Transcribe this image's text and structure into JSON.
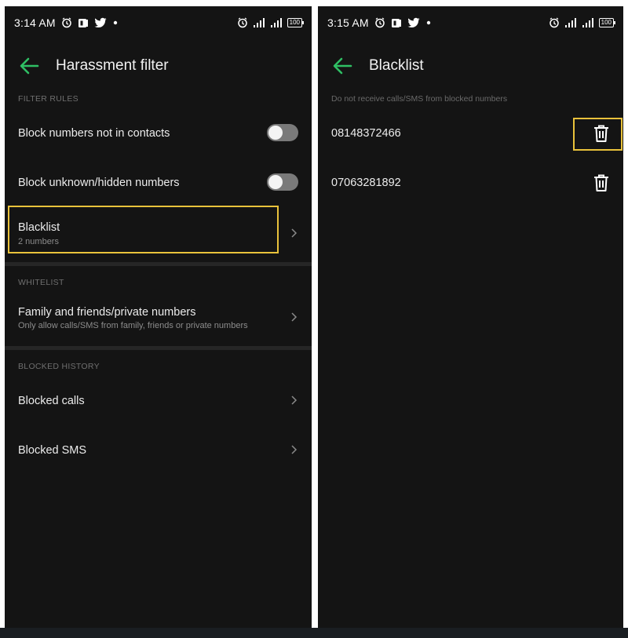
{
  "colors": {
    "accent_green": "#2fbf64",
    "highlight_yellow": "#e9c23b",
    "background": "#141414"
  },
  "left_screen": {
    "status_bar": {
      "time": "3:14 AM",
      "left_icons": [
        "alarm-icon",
        "app-notification-icon",
        "twitter-icon",
        "dot-icon"
      ],
      "right_icons": [
        "alarm-icon",
        "signal-icon",
        "signal-icon",
        "battery-icon"
      ],
      "battery": "100"
    },
    "header": {
      "title": "Harassment filter",
      "back_icon": "back-arrow-icon"
    },
    "filter_rules": {
      "section_label": "FILTER RULES",
      "block_not_in_contacts": {
        "label": "Block numbers not in contacts",
        "enabled": false
      },
      "block_unknown_hidden": {
        "label": "Block unknown/hidden numbers",
        "enabled": false
      },
      "blacklist": {
        "label": "Blacklist",
        "subtitle": "2 numbers"
      }
    },
    "whitelist": {
      "section_label": "WHITELIST",
      "family_friends": {
        "label": "Family and friends/private numbers",
        "subtitle": "Only allow calls/SMS from family, friends or private numbers"
      }
    },
    "blocked_history": {
      "section_label": "BLOCKED HISTORY",
      "blocked_calls": "Blocked calls",
      "blocked_sms": "Blocked SMS"
    }
  },
  "right_screen": {
    "status_bar": {
      "time": "3:15 AM",
      "left_icons": [
        "alarm-icon",
        "app-notification-icon",
        "twitter-icon",
        "dot-icon"
      ],
      "right_icons": [
        "alarm-icon",
        "signal-icon",
        "signal-icon",
        "battery-icon"
      ],
      "battery": "100"
    },
    "header": {
      "title": "Blacklist",
      "back_icon": "back-arrow-icon"
    },
    "description": "Do not receive calls/SMS from blocked numbers",
    "numbers": [
      {
        "number": "08148372466",
        "delete_icon": "trash-icon"
      },
      {
        "number": "07063281892",
        "delete_icon": "trash-icon"
      }
    ]
  }
}
